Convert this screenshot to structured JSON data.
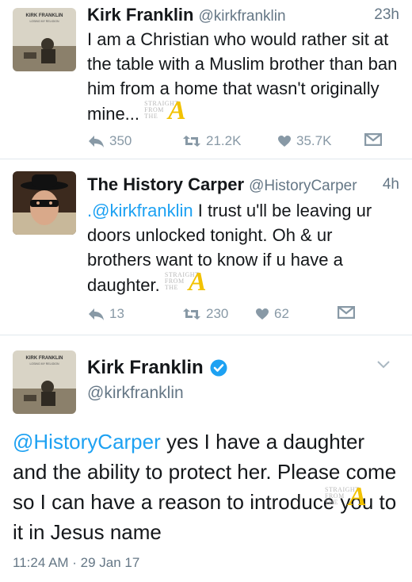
{
  "tweets": [
    {
      "name": "Kirk Franklin",
      "handle": "@kirkfranklin",
      "time": "23h",
      "avatar_caption": "KIRK FRANKLIN",
      "avatar_subcaption": "LOSING MY RELIGION",
      "text": "I am a Christian who would rather sit at the table with a Muslim brother than ban him from a home that wasn't originally mine...",
      "replies": "350",
      "retweets": "21.2K",
      "likes": "35.7K"
    },
    {
      "name": "The History Carper",
      "handle": "@HistoryCarper",
      "time": "4h",
      "mention": ".@kirkfranklin",
      "text": "I trust u'll be leaving ur doors unlocked tonight. Oh & ur brothers want to know if u have a daughter.",
      "replies": "13",
      "retweets": "230",
      "likes": "62"
    },
    {
      "name": "Kirk Franklin",
      "handle": "@kirkfranklin",
      "avatar_caption": "KIRK FRANKLIN",
      "avatar_subcaption": "LOSING MY RELIGION",
      "mention": "@HistoryCarper",
      "text": "yes I have a daughter and the ability to protect her. Please come so I can have a reason to introduce you to it in Jesus name",
      "timestamp": "11:24 AM · 29 Jan 17"
    }
  ],
  "watermark": {
    "line1": "STRAIGHT",
    "line2": "FROM",
    "line3": "THE",
    "letter": "A"
  },
  "colors": {
    "link": "#1da1f2",
    "secondary": "#657786",
    "action": "#8899a6",
    "verified": "#1da1f2"
  },
  "icons": [
    "reply-icon",
    "retweet-icon",
    "like-icon",
    "dm-icon",
    "verified-badge-icon",
    "chevron-down-icon"
  ]
}
